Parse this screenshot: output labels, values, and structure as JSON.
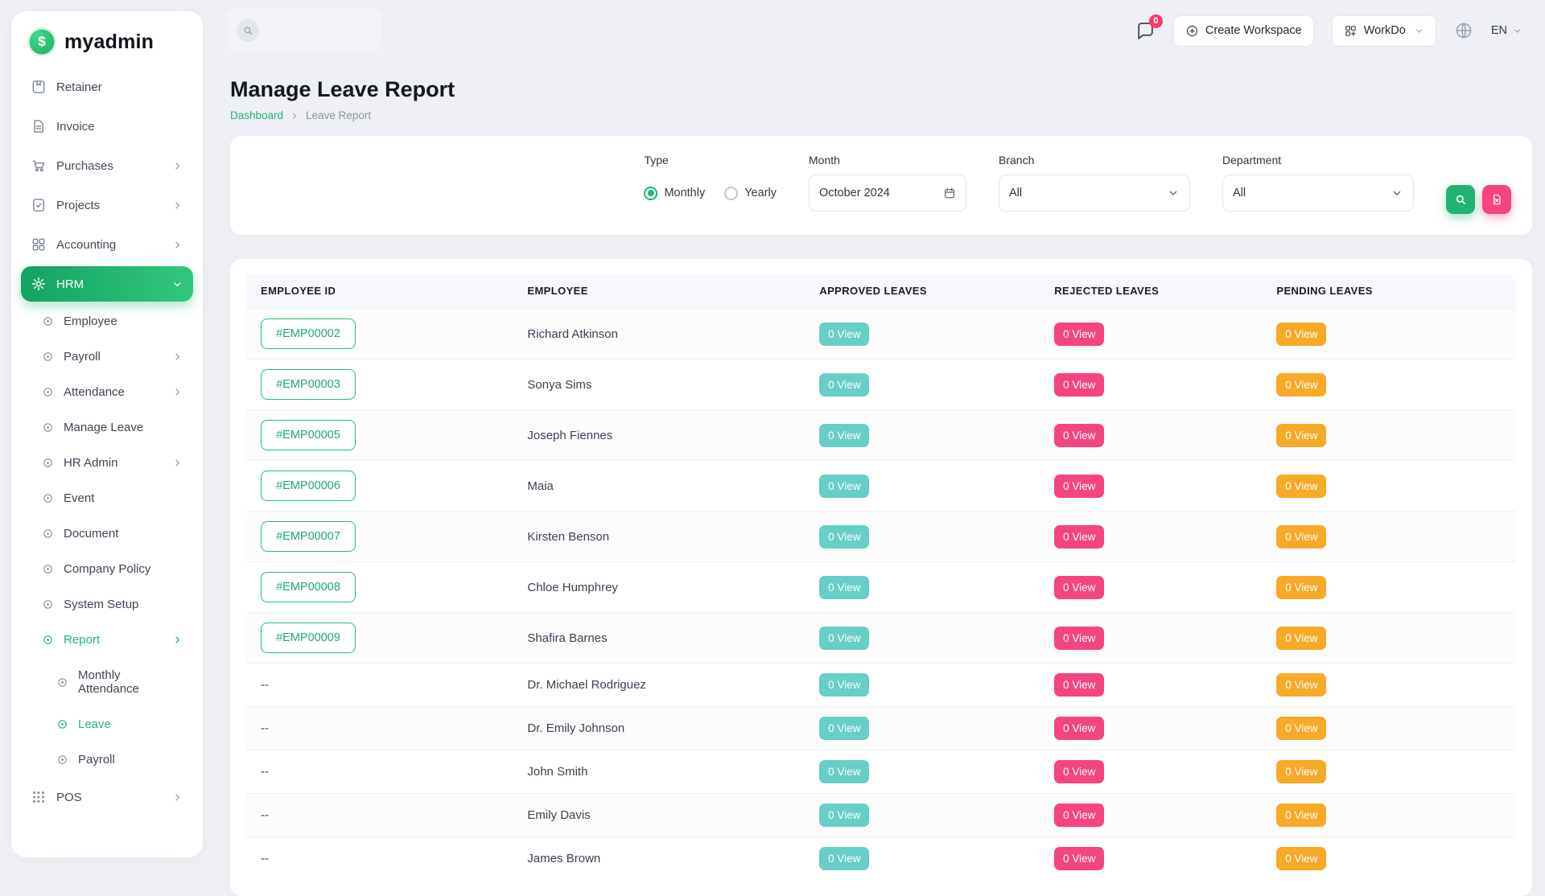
{
  "brand": {
    "name": "myadmin",
    "logo_symbol": "$"
  },
  "topbar": {
    "chat_badge": "0",
    "create_workspace_label": "Create Workspace",
    "workspace_name": "WorkDo",
    "language": "EN"
  },
  "sidebar": {
    "items": [
      {
        "label": "Retainer"
      },
      {
        "label": "Invoice"
      },
      {
        "label": "Purchases"
      },
      {
        "label": "Projects"
      },
      {
        "label": "Accounting"
      },
      {
        "label": "HRM"
      }
    ],
    "hrm_children": [
      {
        "label": "Employee"
      },
      {
        "label": "Payroll"
      },
      {
        "label": "Attendance"
      },
      {
        "label": "Manage Leave"
      },
      {
        "label": "HR Admin"
      },
      {
        "label": "Event"
      },
      {
        "label": "Document"
      },
      {
        "label": "Company Policy"
      },
      {
        "label": "System Setup"
      },
      {
        "label": "Report"
      }
    ],
    "report_children": [
      {
        "label": "Monthly Attendance"
      },
      {
        "label": "Leave"
      },
      {
        "label": "Payroll"
      }
    ],
    "pos": {
      "label": "POS"
    }
  },
  "page": {
    "title": "Manage Leave Report",
    "breadcrumb": {
      "home": "Dashboard",
      "current": "Leave Report"
    }
  },
  "filters": {
    "type_label": "Type",
    "monthly_label": "Monthly",
    "yearly_label": "Yearly",
    "selected_type": "Monthly",
    "month_label": "Month",
    "month_value": "October 2024",
    "branch_label": "Branch",
    "branch_value": "All",
    "department_label": "Department",
    "department_value": "All"
  },
  "table": {
    "columns": [
      "EMPLOYEE ID",
      "EMPLOYEE",
      "APPROVED LEAVES",
      "REJECTED LEAVES",
      "PENDING LEAVES"
    ],
    "rows": [
      {
        "id": "#EMP00002",
        "name": "Richard Atkinson",
        "approved": "0 View",
        "rejected": "0 View",
        "pending": "0 View"
      },
      {
        "id": "#EMP00003",
        "name": "Sonya Sims",
        "approved": "0 View",
        "rejected": "0 View",
        "pending": "0 View"
      },
      {
        "id": "#EMP00005",
        "name": "Joseph Fiennes",
        "approved": "0 View",
        "rejected": "0 View",
        "pending": "0 View"
      },
      {
        "id": "#EMP00006",
        "name": "Maia",
        "approved": "0 View",
        "rejected": "0 View",
        "pending": "0 View"
      },
      {
        "id": "#EMP00007",
        "name": "Kirsten Benson",
        "approved": "0 View",
        "rejected": "0 View",
        "pending": "0 View"
      },
      {
        "id": "#EMP00008",
        "name": "Chloe Humphrey",
        "approved": "0 View",
        "rejected": "0 View",
        "pending": "0 View"
      },
      {
        "id": "#EMP00009",
        "name": "Shafira Barnes",
        "approved": "0 View",
        "rejected": "0 View",
        "pending": "0 View"
      },
      {
        "id": "--",
        "name": "Dr. Michael Rodriguez",
        "approved": "0 View",
        "rejected": "0 View",
        "pending": "0 View"
      },
      {
        "id": "--",
        "name": "Dr. Emily Johnson",
        "approved": "0 View",
        "rejected": "0 View",
        "pending": "0 View"
      },
      {
        "id": "--",
        "name": "John Smith",
        "approved": "0 View",
        "rejected": "0 View",
        "pending": "0 View"
      },
      {
        "id": "--",
        "name": "Emily Davis",
        "approved": "0 View",
        "rejected": "0 View",
        "pending": "0 View"
      },
      {
        "id": "--",
        "name": "James Brown",
        "approved": "0 View",
        "rejected": "0 View",
        "pending": "0 View"
      }
    ]
  },
  "colors": {
    "primary": "#21b373",
    "approved_badge": "#67cfc5",
    "rejected_badge": "#f5457e",
    "pending_badge": "#f7a928",
    "notification_badge": "#fb3b64"
  }
}
